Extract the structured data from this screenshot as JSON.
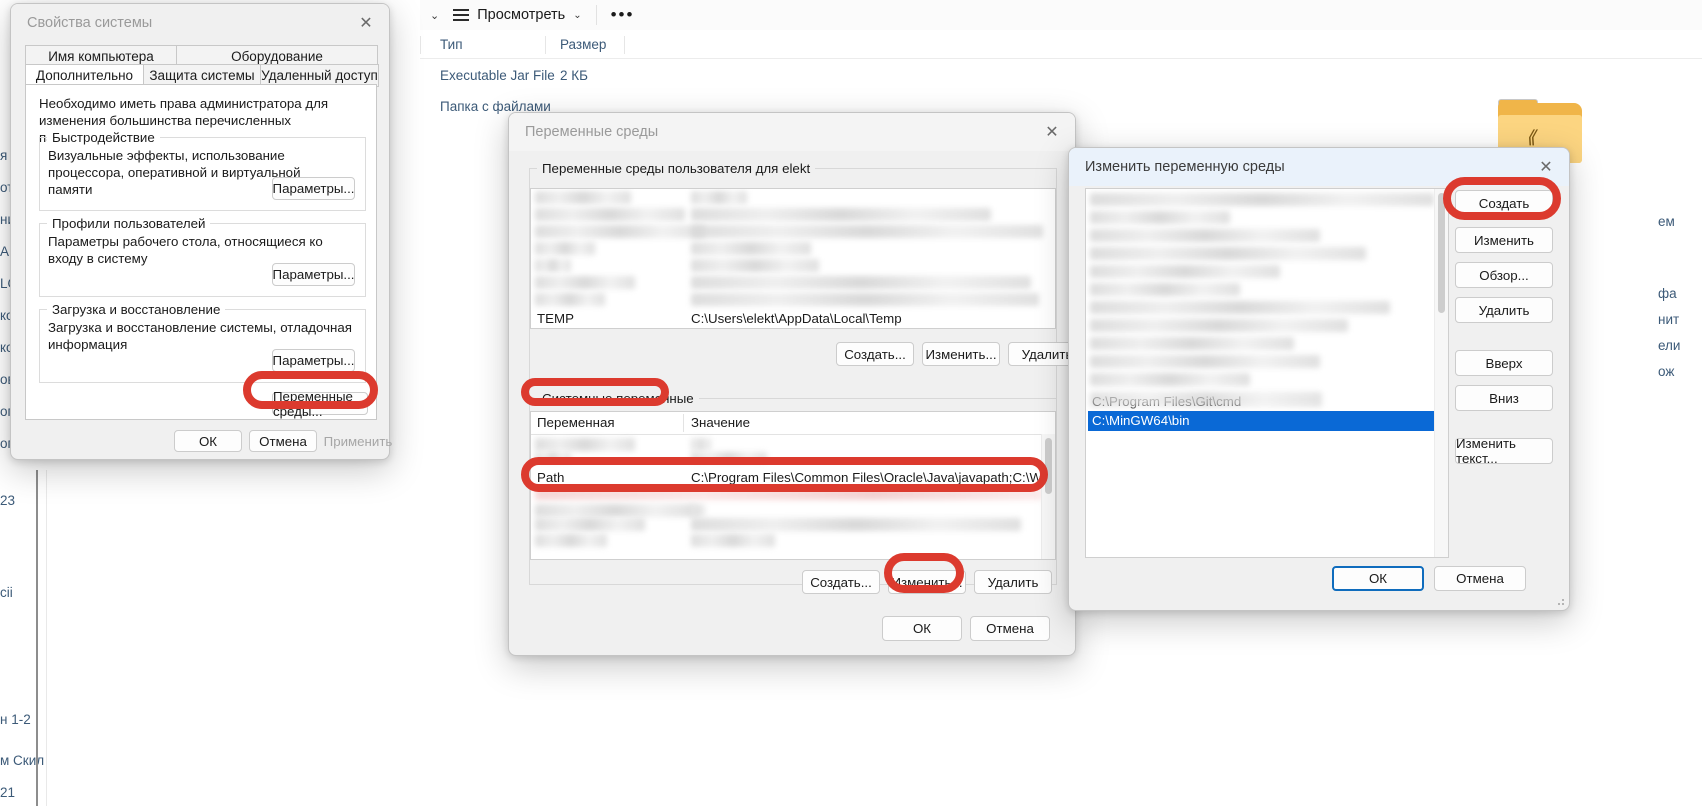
{
  "explorer": {
    "toolbar": {
      "view_label": "Просмотреть",
      "more_label": "•••",
      "chevron": "⌄"
    },
    "columns": [
      {
        "label": "Тип"
      },
      {
        "label": "Размер"
      }
    ],
    "rows": [
      {
        "type": "Executable Jar File",
        "size": "2 КБ"
      },
      {
        "type": "Папка с файлами",
        "size": ""
      }
    ],
    "left_fragments": [
      "я",
      "от",
      "ни",
      "АР",
      "LO",
      "ко",
      "ко",
      "ов",
      "ог",
      "ог",
      "23",
      "сіі",
      "н 1-2",
      "м Скил",
      "21"
    ],
    "right_fragments": [
      "ем",
      "фа",
      "нит",
      "ели",
      "ож"
    ]
  },
  "system_properties": {
    "title": "Свойства системы",
    "close_icon": "✕",
    "tabs_row1": [
      {
        "label": "Имя компьютера",
        "active": false
      },
      {
        "label": "Оборудование",
        "active": false
      }
    ],
    "tabs_row2": [
      {
        "label": "Дополнительно",
        "active": true
      },
      {
        "label": "Защита системы",
        "active": false
      },
      {
        "label": "Удаленный доступ",
        "active": false
      }
    ],
    "intro": "Необходимо иметь права администратора для изменения большинства перечисленных параметров.",
    "groups": [
      {
        "legend": "Быстродействие",
        "text": "Визуальные эффекты, использование процессора, оперативной и виртуальной памяти",
        "button": "Параметры..."
      },
      {
        "legend": "Профили пользователей",
        "text": "Параметры рабочего стола, относящиеся ко входу в систему",
        "button": "Параметры..."
      },
      {
        "legend": "Загрузка и восстановление",
        "text": "Загрузка и восстановление системы, отладочная информация",
        "button": "Параметры..."
      }
    ],
    "env_button": "Переменные среды...",
    "ok": "ОК",
    "cancel": "Отмена",
    "apply": "Применить"
  },
  "env_vars": {
    "title": "Переменные среды",
    "close_icon": "✕",
    "user_group_legend": "Переменные среды пользователя для elekt",
    "user_last_row": {
      "name": "TEMP",
      "value": "C:\\Users\\elekt\\AppData\\Local\\Temp"
    },
    "user_buttons": {
      "create": "Создать...",
      "edit": "Изменить...",
      "delete": "Удалить"
    },
    "system_group_legend": "Системные переменные",
    "system_columns": [
      {
        "label": "Переменная"
      },
      {
        "label": "Значение"
      }
    ],
    "system_selected_row": {
      "name": "Path",
      "value": "C:\\Program Files\\Common Files\\Oracle\\Java\\javapath;C:\\Windows..."
    },
    "system_buttons": {
      "create": "Создать...",
      "edit": "Изменить...",
      "delete": "Удалить"
    },
    "ok": "ОК",
    "cancel": "Отмена"
  },
  "edit_env": {
    "title": "Изменить переменную среды",
    "close_icon": "✕",
    "list_rows": [
      {
        "value": "C:\\Program Files\\Git\\cmd",
        "selected": false,
        "blurred": true
      },
      {
        "value": "C:\\MinGW64\\bin",
        "selected": true,
        "blurred": false
      }
    ],
    "buttons": {
      "create": "Создать",
      "edit": "Изменить",
      "browse": "Обзор...",
      "delete": "Удалить",
      "up": "Вверх",
      "down": "Вниз",
      "edit_text": "Изменить текст..."
    },
    "ok": "ОК",
    "cancel": "Отмена"
  },
  "annotations": {
    "accent_color": "#dc3a2e",
    "items": [
      {
        "target": "env-vars-button"
      },
      {
        "target": "system-variables-legend"
      },
      {
        "target": "path-row"
      },
      {
        "target": "system-edit-button"
      },
      {
        "target": "create-button"
      }
    ]
  }
}
